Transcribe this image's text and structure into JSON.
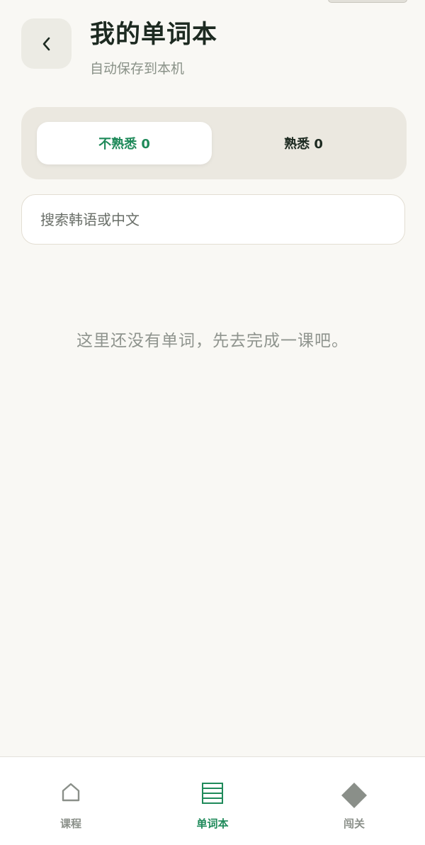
{
  "header": {
    "title": "我的单词本",
    "subtitle": "自动保存到本机",
    "back_icon": "chevron-left-icon"
  },
  "tabs": [
    {
      "label": "不熟悉 0",
      "active": true
    },
    {
      "label": "熟悉 0",
      "active": false
    }
  ],
  "search": {
    "placeholder": "搜索韩语或中文",
    "value": ""
  },
  "empty_state": {
    "message": "这里还没有单词，先去完成一课吧。"
  },
  "bottom_nav": {
    "items": [
      {
        "label": "课程",
        "icon": "home-icon",
        "active": false
      },
      {
        "label": "单词本",
        "icon": "list-icon",
        "active": true
      },
      {
        "label": "闯关",
        "icon": "diamond-icon",
        "active": false
      }
    ]
  },
  "colors": {
    "accent": "#1f8a5a",
    "background": "#f9f8f4",
    "inactive": "#8a8f89"
  }
}
